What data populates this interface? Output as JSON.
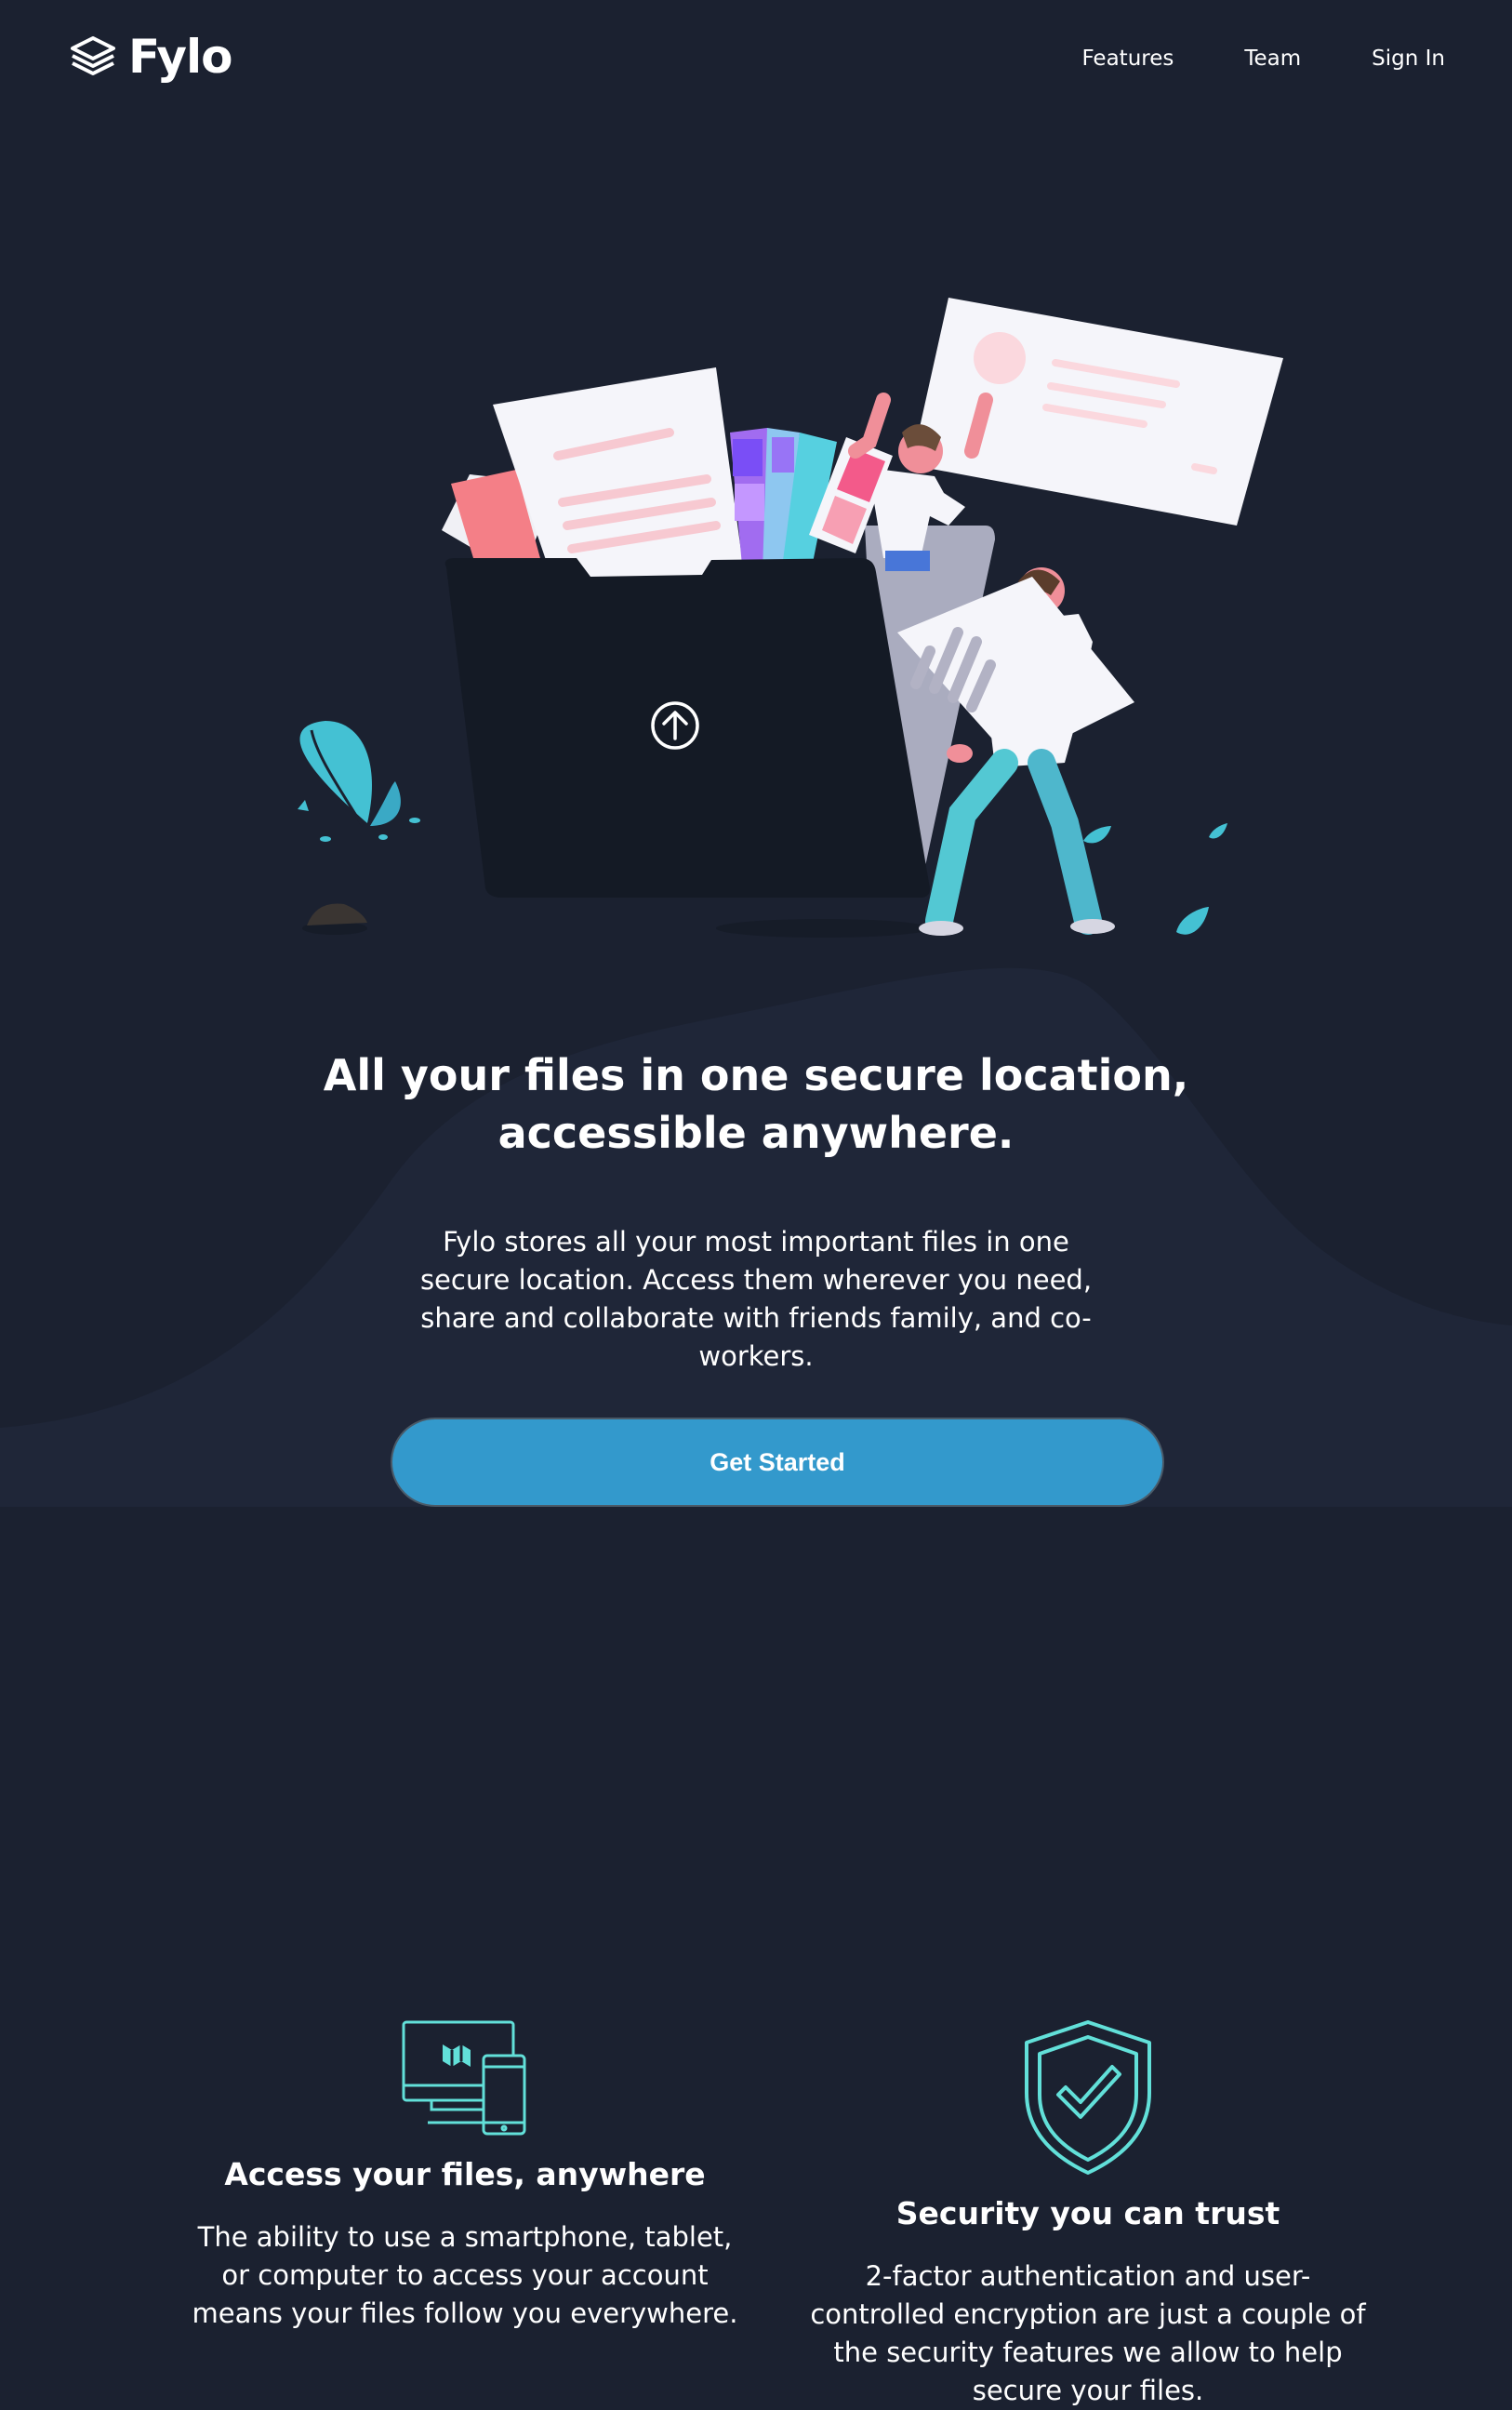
{
  "brand": {
    "name": "Fylo"
  },
  "nav": {
    "items": [
      "Features",
      "Team",
      "Sign In"
    ]
  },
  "hero": {
    "title_line1": "All your files in one secure location,",
    "title_line2": "accessible anywhere.",
    "description": "Fylo stores all your most important files in one secure location. Access them wherever you need, share and collaborate with friends family, and co-workers.",
    "cta_label": "Get Started"
  },
  "features": [
    {
      "icon": "devices-icon",
      "title": "Access your files, anywhere",
      "description": "The ability to use a smartphone, tablet, or computer to access your account means your files follow you everywhere."
    },
    {
      "icon": "shield-check-icon",
      "title": "Security you can trust",
      "description": "2-factor authentication and user-controlled encryption are just a couple of the security features we allow to help secure your files."
    }
  ],
  "colors": {
    "background": "#1b2130",
    "curve": "#1f2638",
    "accent": "#3399cc",
    "icon_teal": "#62e0d9",
    "folder": "#141a25"
  }
}
